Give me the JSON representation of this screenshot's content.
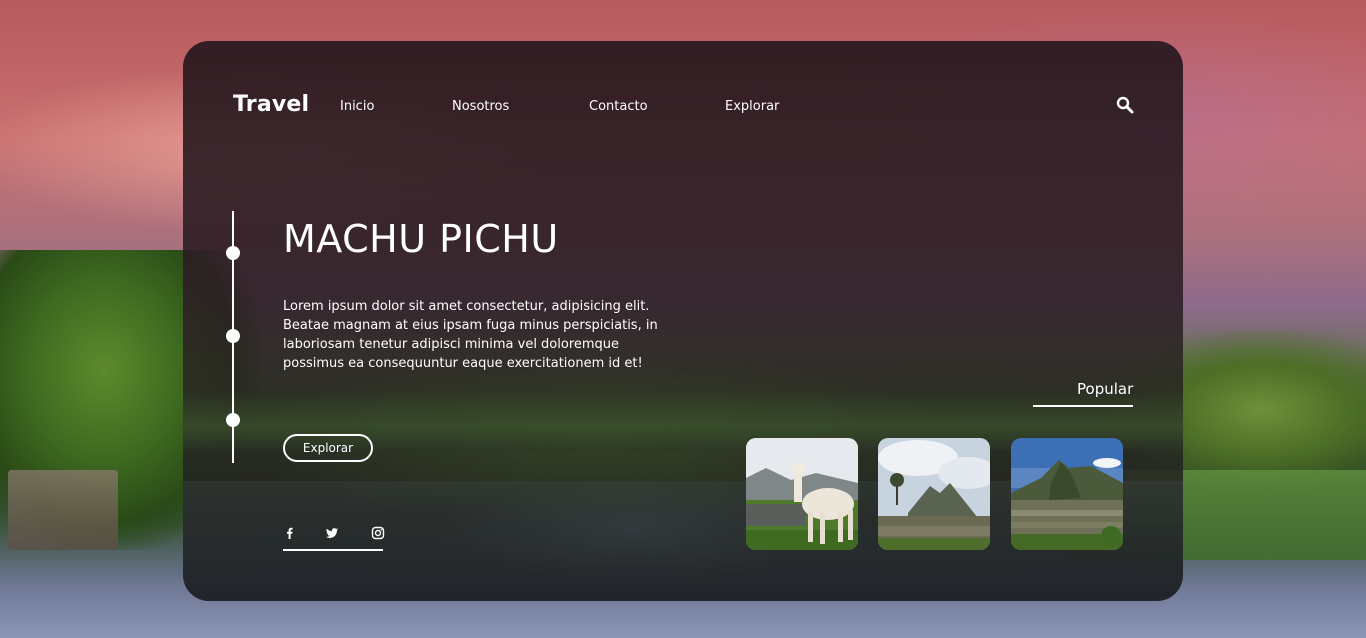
{
  "brand": {
    "logo": "Travel"
  },
  "nav": {
    "items": [
      {
        "label": "Inicio"
      },
      {
        "label": "Nosotros"
      },
      {
        "label": "Contacto"
      },
      {
        "label": "Explorar"
      }
    ],
    "search_icon": "search-icon"
  },
  "hero": {
    "title": "MACHU PICHU",
    "description": "Lorem ipsum dolor sit amet consectetur, adipisicing elit. Beatae magnam at eius ipsam fuga minus perspiciatis, in laboriosam tenetur adipisci minima vel doloremque possimus ea consequuntur eaque exercitationem id et!",
    "button_label": "Explorar"
  },
  "social": {
    "icons": [
      "facebook-icon",
      "twitter-icon",
      "instagram-icon"
    ]
  },
  "popular": {
    "label": "Popular",
    "cards": [
      "llama-photo",
      "mountain-ruins-photo",
      "machu-picchu-photo"
    ]
  },
  "colors": {
    "text": "#ffffff",
    "card_overlay": "#2a1e24"
  }
}
